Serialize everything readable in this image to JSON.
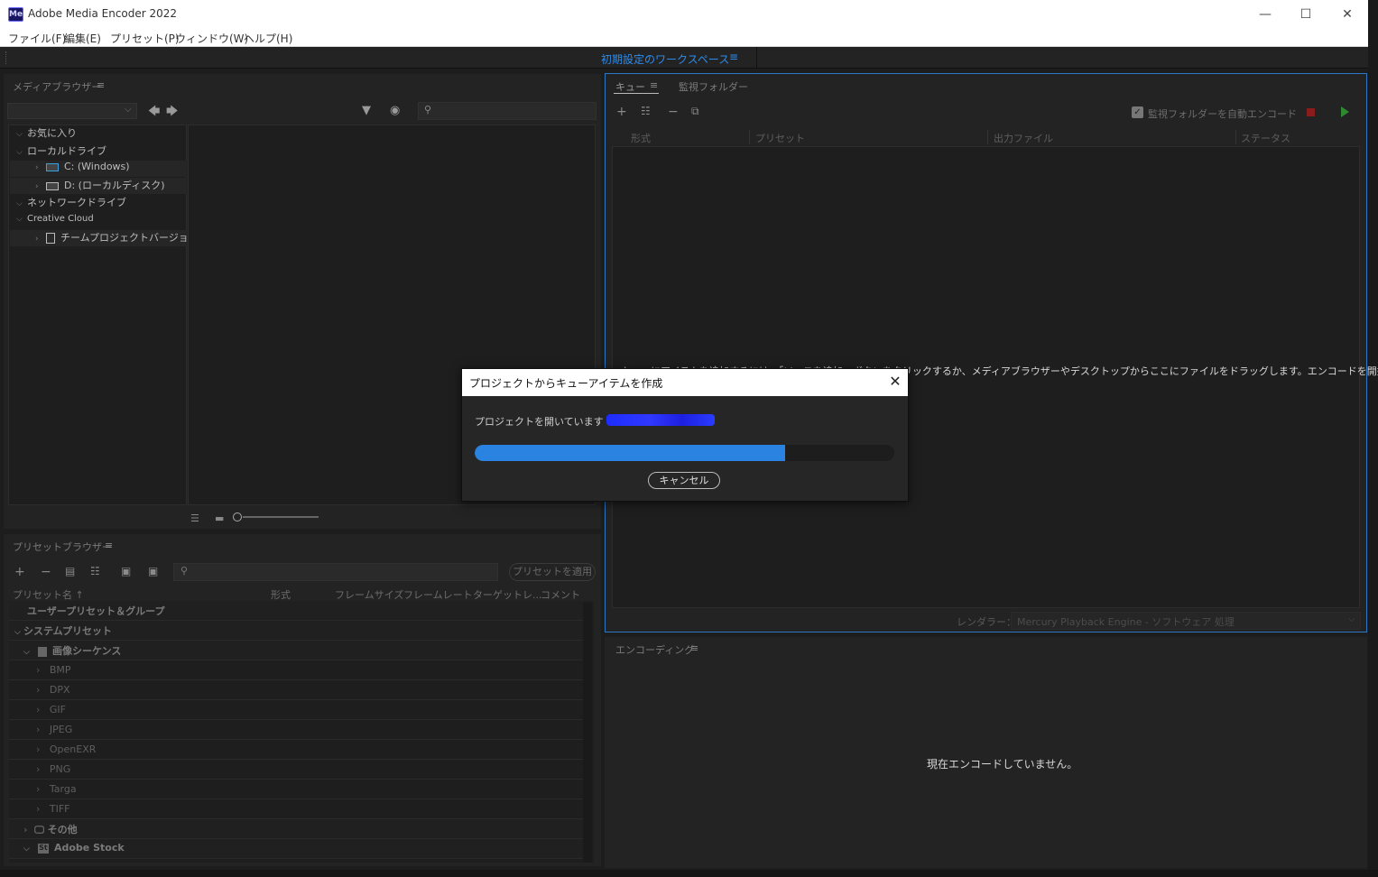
{
  "window": {
    "title": "Adobe Media Encoder 2022",
    "icon_text": "Me",
    "controls": [
      "—",
      "☐",
      "✕"
    ]
  },
  "menu": [
    "ファイル(F)",
    "編集(E)",
    "プリセット(P)",
    "ウィンドウ(W)",
    "ヘルプ(H)"
  ],
  "workspace": {
    "label": "初期設定のワークスペース",
    "menu_icon": "≡"
  },
  "media_browser": {
    "title": "メディアブラウザー",
    "menu_icon": "≡",
    "tree": [
      {
        "label": "お気に入り",
        "level": 0,
        "icon": ""
      },
      {
        "label": "ローカルドライブ",
        "level": 0,
        "icon": ""
      },
      {
        "label": "C: (Windows)",
        "level": 1,
        "icon": "windows-drive-icon"
      },
      {
        "label": "D: (ローカルディスク)",
        "level": 1,
        "icon": "hard-drive-icon"
      },
      {
        "label": "ネットワークドライブ",
        "level": 0,
        "icon": ""
      },
      {
        "label": "Creative Cloud",
        "level": 0,
        "icon": ""
      },
      {
        "label": "チームプロジェクトバージョン",
        "level": 1,
        "icon": "team-project-icon"
      }
    ]
  },
  "preset_browser": {
    "title": "プリセットブラウザー",
    "menu_icon": "≡",
    "apply_label": "プリセットを適用",
    "columns": [
      "プリセット名 ↑",
      "形式",
      "フレームサイズ",
      "フレームレート",
      "ターゲットレ...",
      "コメント"
    ],
    "rows": [
      {
        "label": "ユーザープリセット＆グループ",
        "kind": "group",
        "indent": 0
      },
      {
        "label": "システムプリセット",
        "kind": "group",
        "indent": 0
      },
      {
        "label": "画像シーケンス",
        "kind": "group",
        "indent": 1
      },
      {
        "label": "BMP",
        "kind": "item",
        "indent": 2
      },
      {
        "label": "DPX",
        "kind": "item",
        "indent": 2
      },
      {
        "label": "GIF",
        "kind": "item",
        "indent": 2
      },
      {
        "label": "JPEG",
        "kind": "item",
        "indent": 2
      },
      {
        "label": "OpenEXR",
        "kind": "item",
        "indent": 2
      },
      {
        "label": "PNG",
        "kind": "item",
        "indent": 2
      },
      {
        "label": "Targa",
        "kind": "item",
        "indent": 2
      },
      {
        "label": "TIFF",
        "kind": "item",
        "indent": 2
      },
      {
        "label": "その他",
        "kind": "group",
        "indent": 1
      },
      {
        "label": "Adobe Stock",
        "kind": "group",
        "indent": 1
      }
    ]
  },
  "queue": {
    "tab_queue": "キュー",
    "tab_watch": "監視フォルダー",
    "menu_icon": "≡",
    "auto_encode_label": "監視フォルダーを自動エンコード",
    "columns": [
      "形式",
      "プリセット",
      "出力ファイル",
      "ステータス"
    ],
    "hint": "キューにアイテムを追加するには、「ソースを追加」ボタンをクリックするか、メディアブラウザーやデスクトップからここにファイルをドラッグします。エンコードを開始 するには、",
    "renderer_label": "レンダラー：",
    "renderer_value": "Mercury Playback Engine - ソフトウェア 処理"
  },
  "encoding": {
    "title": "エンコーディング",
    "menu_icon": "≡",
    "status": "現在エンコードしていません。"
  },
  "dialog": {
    "title": "プロジェクトからキューアイテムを作成",
    "message": "プロジェクトを開いています : 2",
    "progress": 0.74,
    "cancel_label": "キャンセル",
    "close_icon": "✕"
  },
  "colors": {
    "accent_blue": "#2d8ceb",
    "progress_blue": "#2a83e0",
    "stop_red": "#8b1c1c",
    "play_green": "#2f8a2f"
  }
}
